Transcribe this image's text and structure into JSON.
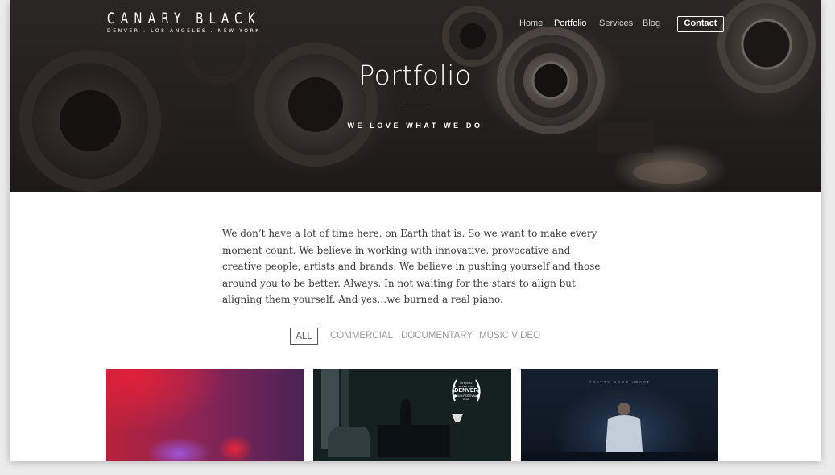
{
  "brand": {
    "name": "CANARY BLACK",
    "locations": "DENVER . LOS ANGELES . NEW YORK"
  },
  "nav": {
    "items": [
      {
        "label": "Home",
        "active": false
      },
      {
        "label": "Portfolio",
        "active": true
      },
      {
        "label": "Services",
        "active": false
      },
      {
        "label": "Blog",
        "active": false
      }
    ],
    "contact_label": "Contact"
  },
  "hero": {
    "title": "Portfolio",
    "tagline": "WE LOVE WHAT WE DO"
  },
  "intro": {
    "text": "We don’t have a lot of time here, on Earth that is. So we want to make every moment count. We believe in working with innovative, provocative and creative people, artists and brands. We believe in pushing yourself and those around you to be better. Always. In not waiting for the stars to align but aligning them yourself. And yes…we burned a real piano."
  },
  "filters": [
    {
      "label": "ALL",
      "active": true
    },
    {
      "label": "COMMERCIAL",
      "active": false
    },
    {
      "label": "DOCUMENTARY",
      "active": false
    },
    {
      "label": "MUSIC VIDEO",
      "active": false
    }
  ],
  "thumbnails": [
    {
      "name": "red-abstract-thumbnail"
    },
    {
      "name": "piano-room-thumbnail",
      "laurel": {
        "top": "OFFICIAL SELECTION",
        "main": "DENVER",
        "sub": "FILM FESTIVAL",
        "year": "2013"
      }
    },
    {
      "name": "pretty-good-heart-thumbnail",
      "caption": "PRETTY GOOD HEART"
    }
  ],
  "colors": {
    "hero_overlay": "#1d1a19",
    "accent_white": "#ffffff",
    "body_text": "#3a3a3a",
    "filter_inactive": "#9c9c9c"
  }
}
